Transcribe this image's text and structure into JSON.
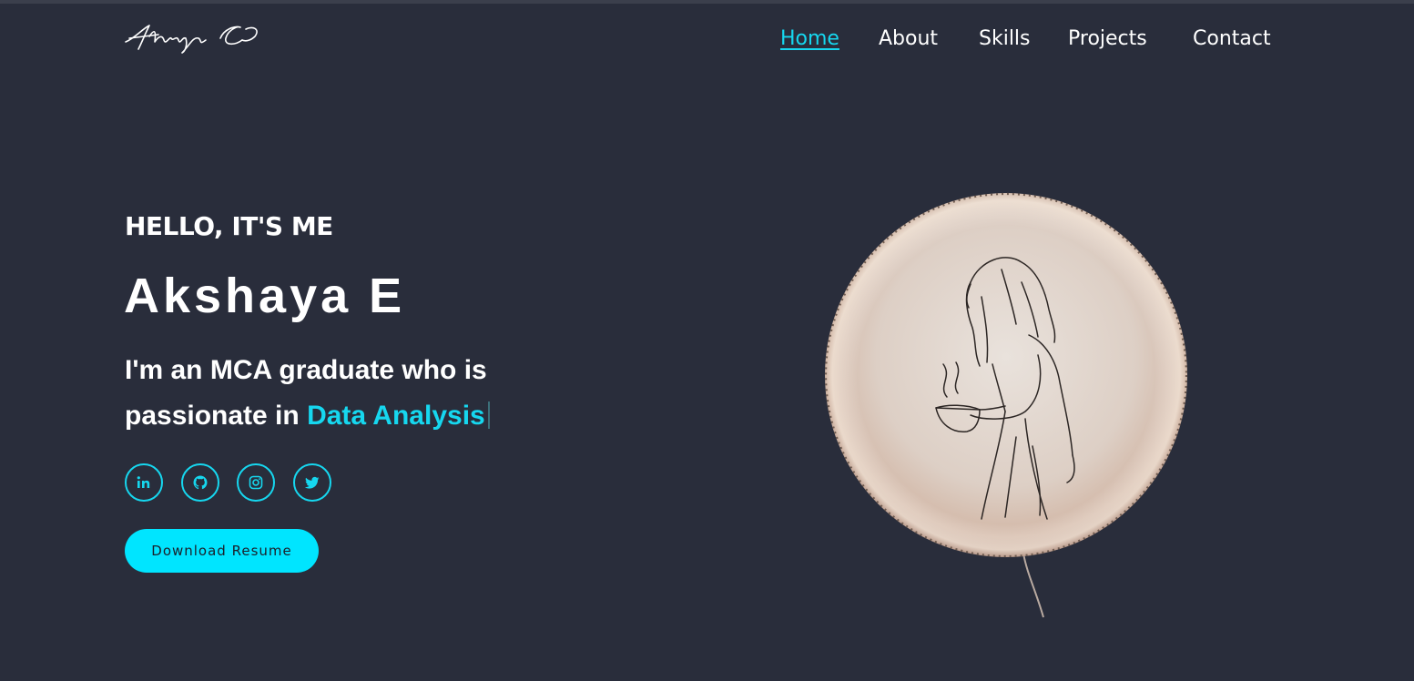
{
  "header": {
    "logo_text": "Akshaya E",
    "nav": [
      {
        "label": "Home",
        "active": true
      },
      {
        "label": "About",
        "active": false
      },
      {
        "label": "Skills",
        "active": false
      },
      {
        "label": "Projects",
        "active": false
      },
      {
        "label": "Contact",
        "active": false
      }
    ]
  },
  "hero": {
    "greeting": "HELLO, IT'S ME",
    "name": "Akshaya E",
    "desc_line1": "I'm an MCA graduate who is",
    "desc_line2_prefix": "passionate in ",
    "desc_highlight": "Data Analysis",
    "socials": [
      {
        "icon": "linkedin-icon"
      },
      {
        "icon": "github-icon"
      },
      {
        "icon": "instagram-icon"
      },
      {
        "icon": "twitter-icon"
      }
    ],
    "resume_button": "Download Resume"
  },
  "colors": {
    "background": "#292d3b",
    "accent": "#16d7ef",
    "button": "#00e5ff",
    "text": "#ffffff"
  }
}
